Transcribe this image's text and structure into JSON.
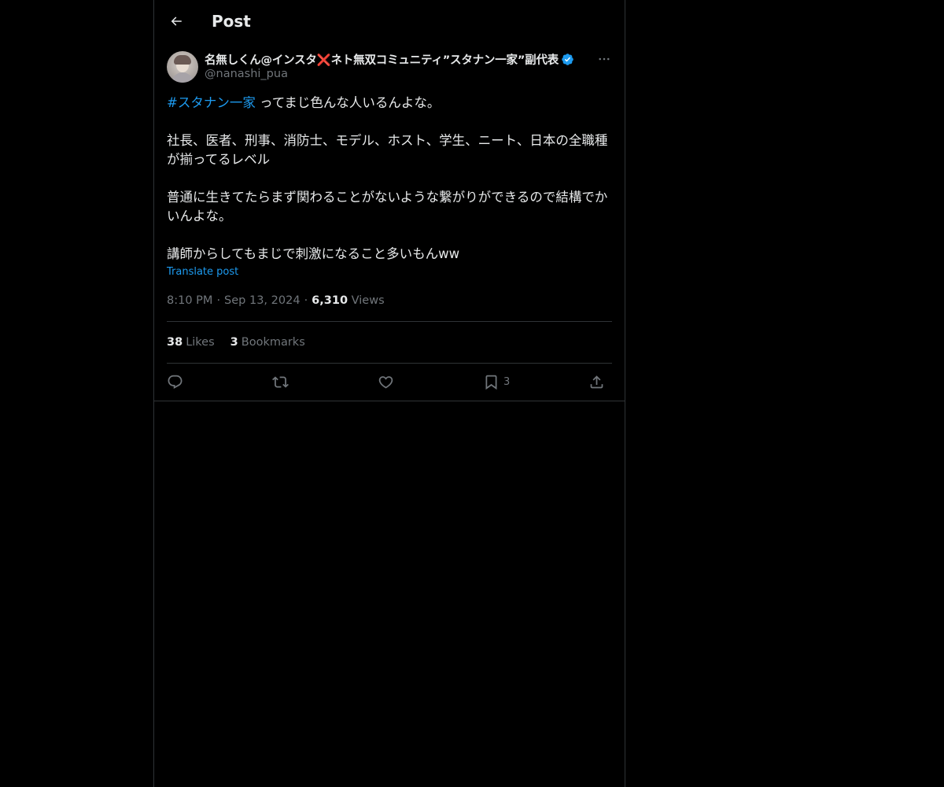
{
  "header": {
    "title": "Post",
    "back_icon": "arrow-left-icon"
  },
  "author": {
    "display_name": "名無しくん@インスタ❌ネト無双コミュニティ”スタナン一家”副代表",
    "handle": "@nanashi_pua",
    "verified": true,
    "verified_color": "#1d9bf0"
  },
  "tweet": {
    "hashtag": "#スタナン一家",
    "line1_rest": " ってまじ色んな人いるんよな。",
    "para2": "社長、医者、刑事、消防士、モデル、ホスト、学生、ニート、日本の全職種が揃ってるレベル",
    "para3": "普通に生きてたらまず関わることがないような繋がりができるので結構でかいんよな。",
    "para4": "講師からしてもまじで刺激になること多いもんww",
    "translate_label": "Translate post"
  },
  "meta": {
    "time": "8:10 PM",
    "date": "Sep 13, 2024",
    "views_count": "6,310",
    "views_label": "Views",
    "separator": "·"
  },
  "stats": {
    "likes_count": "38",
    "likes_label": "Likes",
    "bookmarks_count": "3",
    "bookmarks_label": "Bookmarks"
  },
  "actions": {
    "reply_icon": "reply-icon",
    "repost_icon": "repost-icon",
    "like_icon": "heart-icon",
    "bookmark_icon": "bookmark-icon",
    "bookmark_count": "3",
    "share_icon": "share-icon"
  },
  "colors": {
    "background": "#000000",
    "text": "#e7e9ea",
    "secondary": "#71767b",
    "accent": "#1d9bf0",
    "border": "#2f3336"
  }
}
